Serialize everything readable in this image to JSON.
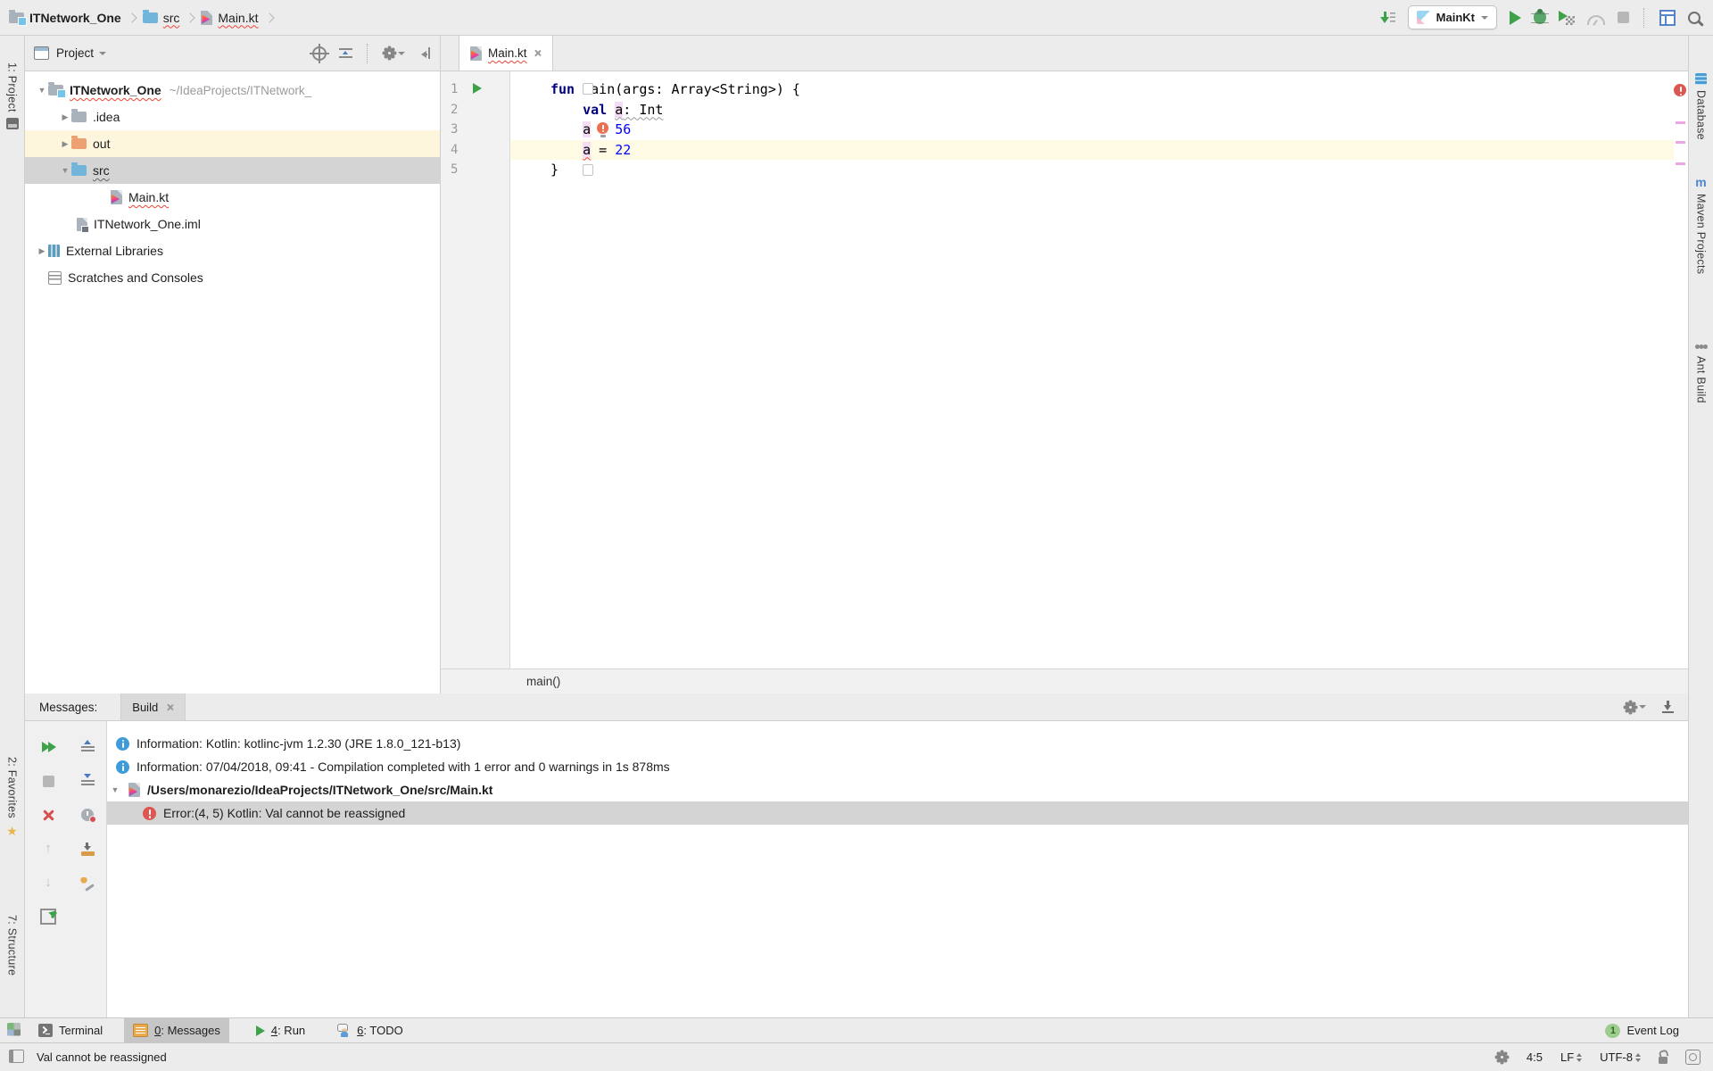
{
  "topbar": {
    "crumbs": [
      "ITNetwork_One",
      "src",
      "Main.kt"
    ],
    "run_config": "MainKt"
  },
  "left_bar": {
    "project": "1: Project",
    "favorites": "2: Favorites",
    "structure": "7: Structure"
  },
  "right_bar": {
    "database": "Database",
    "maven": "Maven Projects",
    "maven_glyph": "m",
    "ant": "Ant Build"
  },
  "project_panel": {
    "title": "Project",
    "tree": [
      {
        "label": "ITNetwork_One",
        "path": "~/IdeaProjects/ITNetwork_"
      },
      {
        "label": ".idea"
      },
      {
        "label": "out"
      },
      {
        "label": "src"
      },
      {
        "label": "Main.kt"
      },
      {
        "label": "ITNetwork_One.iml"
      },
      {
        "label": "External Libraries"
      },
      {
        "label": "Scratches and Consoles"
      }
    ]
  },
  "editor": {
    "tab": "Main.kt",
    "lines": [
      "1",
      "2",
      "3",
      "4",
      "5"
    ],
    "code": {
      "indent": "    ",
      "l1_kw": "fun",
      "l1_rest": " main(args: Array<String>) {",
      "l2_kw": "val",
      "l2_sp": " ",
      "l2_var": "a",
      "l2_type": ": Int",
      "l3_var": "a",
      "l3_op": " = ",
      "l3_num": "56",
      "l4_var": "a",
      "l4_op": " = ",
      "l4_num": "22",
      "l5": "}"
    },
    "breadcrumb": "main()"
  },
  "messages": {
    "label": "Messages:",
    "tab": "Build",
    "rows": [
      {
        "text": "Information: Kotlin: kotlinc-jvm 1.2.30 (JRE 1.8.0_121-b13)"
      },
      {
        "text": "Information: 07/04/2018, 09:41 - Compilation completed with 1 error and 0 warnings in 1s 878ms"
      },
      {
        "text": "/Users/monarezio/IdeaProjects/ITNetwork_One/src/Main.kt"
      },
      {
        "text": "Error:(4, 5) Kotlin: Val cannot be reassigned"
      }
    ]
  },
  "bottom_bar": {
    "terminal": "Terminal",
    "messages_num": "0",
    "messages_rest": ": Messages",
    "run_num": "4",
    "run_rest": ": Run",
    "todo_num": "6",
    "todo_rest": ": TODO",
    "event_log": "Event Log",
    "event_count": "1"
  },
  "status_bar": {
    "message": "Val cannot be reassigned",
    "caret": "4:5",
    "line_sep": "LF",
    "encoding": "UTF-8"
  },
  "colors": {
    "keyword": "#000080",
    "number": "#0000ff",
    "error_red": "#dd5650",
    "run_green": "#3fa24a",
    "current_line": "#fffae3",
    "selection_gray": "#d4d4d4",
    "identifier_highlight": "#f4dcf4"
  }
}
